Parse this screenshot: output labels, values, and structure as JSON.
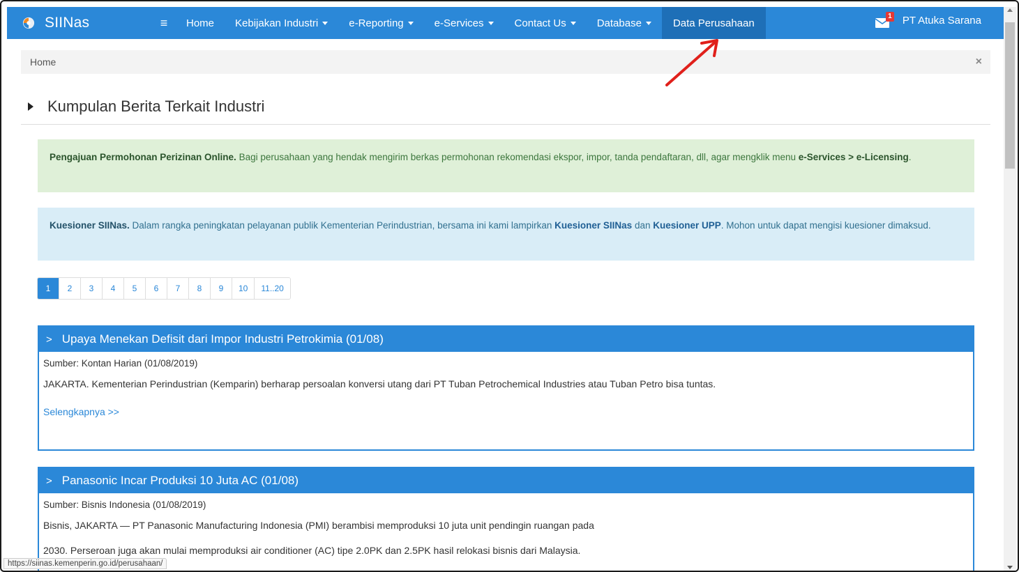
{
  "brand": {
    "name": "SIINas"
  },
  "nav": {
    "home": "Home",
    "kebijakan": "Kebijakan Industri",
    "ereporting": "e-Reporting",
    "eservices": "e-Services",
    "contact": "Contact Us",
    "database": "Database",
    "data_perusahaan": "Data Perusahaan",
    "mail_badge": "1",
    "user": "PT Atuka Sarana"
  },
  "breadcrumb": {
    "home": "Home",
    "close": "×"
  },
  "section": {
    "title": "Kumpulan Berita Terkait Industri"
  },
  "alerts": {
    "green": {
      "lead": "Pengajuan Permohonan Perizinan Online.",
      "text": " Bagi perusahaan yang hendak mengirim berkas permohonan rekomendasi ekspor, impor, tanda pendaftaran, dll, agar mengklik menu ",
      "menu": "e-Services > e-Licensing",
      "end": "."
    },
    "blue": {
      "lead": "Kuesioner SIINas.",
      "text": " Dalam rangka peningkatan pelayanan publik Kementerian Perindustrian, bersama ini kami lampirkan ",
      "link1": "Kuesioner SIINas",
      "mid": " dan ",
      "link2": "Kuesioner UPP",
      "end": ". Mohon untuk dapat mengisi kuesioner dimaksud."
    }
  },
  "pagination": [
    "1",
    "2",
    "3",
    "4",
    "5",
    "6",
    "7",
    "8",
    "9",
    "10",
    "11..20"
  ],
  "news": [
    {
      "title": "Upaya Menekan Defisit dari Impor Industri Petrokimia (01/08)",
      "source": "Sumber: Kontan Harian (01/08/2019)",
      "body": "JAKARTA. Kementerian Perindustrian (Kemparin) berharap persoalan konversi utang dari PT Tuban Petrochemical Industries atau Tuban Petro bisa tuntas.",
      "more": "Selengkapnya >>"
    },
    {
      "title": "Panasonic Incar Produksi 10 Juta AC (01/08)",
      "source": "Sumber: Bisnis Indonesia (01/08/2019)",
      "body": "Bisnis, JAKARTA — PT Panasonic Manufacturing Indonesia (PMI) berambisi memproduksi 10 juta unit pendingin ruangan pada",
      "body2": "2030. Perseroan juga akan mulai memproduksi air conditioner (AC) tipe 2.0PK dan 2.5PK hasil relokasi bisnis dari Malaysia."
    }
  ],
  "statusbar": {
    "url": "https://siinas.kemenperin.go.id/perusahaan/"
  },
  "colors": {
    "primary": "#2b88d8",
    "active_nav": "#1e6fb7",
    "annotation": "#e0201b"
  },
  "icons": {
    "brand": "globe-logo-icon",
    "menu": "hamburger-icon",
    "mail": "envelope-icon",
    "close": "close-icon"
  }
}
